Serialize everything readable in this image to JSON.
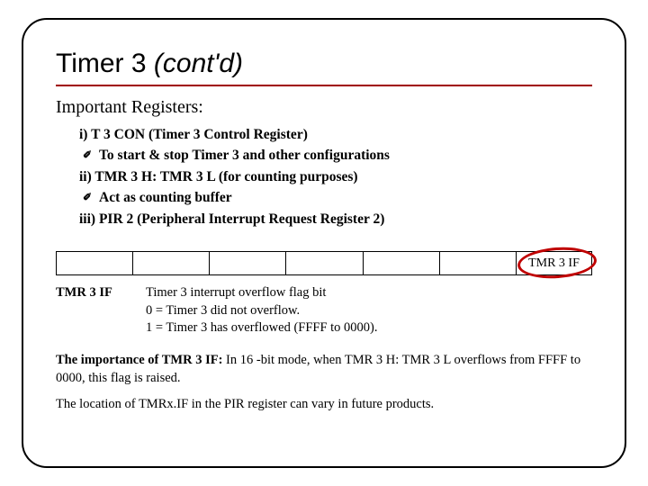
{
  "title": {
    "main": "Timer 3",
    "italic": "(cont'd)"
  },
  "subtitle": "Important Registers:",
  "regs": {
    "i_head": "i) T 3 CON (Timer 3 Control Register)",
    "i_sub": "To start & stop Timer 3 and other configurations",
    "ii_head": "ii) TMR 3 H: TMR 3 L (for counting purposes)",
    "ii_sub": "Act as counting buffer",
    "iii_head": "iii) PIR 2 (Peripheral Interrupt Request Register 2)"
  },
  "bit_label": "TMR 3 IF",
  "desc": {
    "label": "TMR 3 IF",
    "line1": "Timer 3 interrupt overflow flag bit",
    "line2": "0 = Timer 3 did not overflow.",
    "line3": "1 = Timer 3 has overflowed (FFFF to 0000)."
  },
  "footer": {
    "imp_label": "The importance of TMR 3 IF:",
    "imp_body": " In 16 -bit mode, when TMR 3 H: TMR 3 L overflows from FFFF to 0000, this flag is raised.",
    "loc": "The location of TMRx.IF in the PIR register can vary in future products."
  }
}
